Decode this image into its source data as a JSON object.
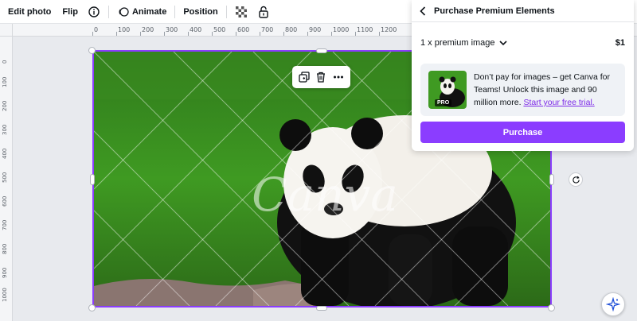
{
  "toolbar": {
    "edit_photo": "Edit photo",
    "flip": "Flip",
    "animate": "Animate",
    "position": "Position"
  },
  "ruler": {
    "top_labels": [
      "0",
      "100",
      "200",
      "300",
      "400",
      "500",
      "600",
      "700",
      "800",
      "900",
      "1000",
      "1100",
      "1200"
    ],
    "left_labels": [
      "0",
      "100",
      "200",
      "300",
      "400",
      "500",
      "600",
      "700",
      "800",
      "900",
      "1000"
    ]
  },
  "canvas": {
    "watermark": "Canva",
    "icons": [
      "duplicate-icon",
      "trash-icon",
      "more-icon"
    ]
  },
  "purchase_panel": {
    "title": "Purchase Premium Elements",
    "item_label": "1 x premium image",
    "price": "$1",
    "pro_badge": "PRO",
    "promo_text": "Don’t pay for images – get Canva for Teams! Unlock this image and 90 million more.",
    "promo_link": "Start your free trial.",
    "button_label": "Purchase"
  },
  "colors": {
    "accent": "#8b3dff",
    "link": "#7d2ae8"
  }
}
